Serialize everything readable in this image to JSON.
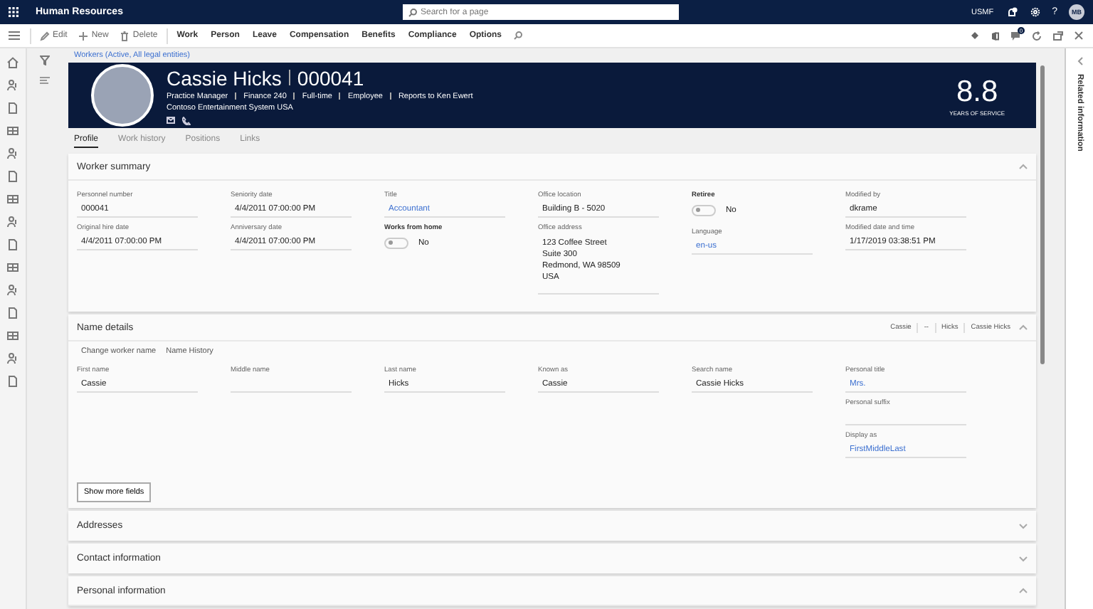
{
  "app_bar": {
    "title": "Human Resources",
    "search": {
      "placeholder": "Search for a page"
    },
    "company": "USMF",
    "help": "?",
    "avatar": "MB"
  },
  "toolbar": {
    "commands": [
      "Edit",
      "New",
      "Delete"
    ],
    "menus": [
      "Work",
      "Person",
      "Leave",
      "Compensation",
      "Benefits",
      "Compliance",
      "Options"
    ],
    "notification_count": "0"
  },
  "breadcrumb": "Workers (Active, All legal entities)",
  "worker": {
    "name": "Cassie Hicks",
    "number": "000041",
    "details": [
      "Practice Manager",
      "Finance 240",
      "Full-time",
      "Employee",
      "Reports to Ken Ewert"
    ],
    "company": "Contoso Entertainment System USA",
    "years": "8.8",
    "years_label": "YEARS OF SERVICE"
  },
  "tabs": [
    {
      "label": "Profile",
      "selected": true
    },
    {
      "label": "Work history",
      "selected": false
    },
    {
      "label": "Positions",
      "selected": false
    },
    {
      "label": "Links",
      "selected": false
    }
  ],
  "sections": [
    {
      "title": "Worker summary",
      "expanded": true,
      "columns": [
        [
          {
            "kind": "text",
            "label": "Personnel number",
            "value": "000041"
          },
          {
            "kind": "text",
            "label": "Original hire date",
            "value": "4/4/2011 07:00:00 PM"
          }
        ],
        [
          {
            "kind": "text",
            "label": "Seniority date",
            "value": "4/4/2011 07:00:00 PM"
          },
          {
            "kind": "text",
            "label": "Anniversary date",
            "value": "4/4/2011 07:00:00 PM"
          }
        ],
        [
          {
            "kind": "link",
            "label": "Title",
            "value": "Accountant"
          },
          {
            "kind": "toggle",
            "label": "Works from home",
            "on": false,
            "value": "No"
          }
        ],
        [
          {
            "kind": "text",
            "label": "Office location",
            "value": "Building B - 5020"
          },
          {
            "kind": "address",
            "label": "Office address",
            "lines": [
              "123 Coffee Street",
              "Suite 300",
              "Redmond, WA 98509",
              "USA"
            ]
          }
        ],
        [
          {
            "kind": "toggle",
            "label": "Retiree",
            "on": false,
            "value": "No"
          },
          {
            "kind": "link",
            "label": "Language",
            "value": "en-us"
          }
        ],
        [
          {
            "kind": "text",
            "label": "Modified by",
            "value": "dkrame"
          },
          {
            "kind": "text",
            "label": "Modified date and time",
            "value": "1/17/2019 03:38:51 PM"
          }
        ]
      ]
    },
    {
      "title": "Name details",
      "expanded": true,
      "summary": [
        "Cassie",
        "--",
        "Hicks",
        "Cassie Hicks"
      ],
      "actions": [
        "Change worker name",
        "Name History"
      ],
      "columns": [
        [
          {
            "kind": "text",
            "label": "First name",
            "value": "Cassie"
          }
        ],
        [
          {
            "kind": "text",
            "label": "Middle name"
          }
        ],
        [
          {
            "kind": "text",
            "label": "Last name",
            "value": "Hicks"
          }
        ],
        [
          {
            "kind": "text",
            "label": "Known as",
            "value": "Cassie"
          }
        ],
        [
          {
            "kind": "text",
            "label": "Search name",
            "value": "Cassie Hicks"
          }
        ],
        [
          {
            "kind": "link",
            "label": "Personal title",
            "value": "Mrs."
          },
          {
            "kind": "text",
            "label": "Personal suffix"
          },
          {
            "kind": "link",
            "label": "Display as",
            "value": "FirstMiddleLast"
          }
        ]
      ],
      "button": "Show more fields"
    },
    {
      "title": "Addresses",
      "expanded": false
    },
    {
      "title": "Contact information",
      "expanded": false
    },
    {
      "title": "Personal information",
      "expanded": true
    }
  ],
  "related_pane": {
    "title": "Related information"
  }
}
